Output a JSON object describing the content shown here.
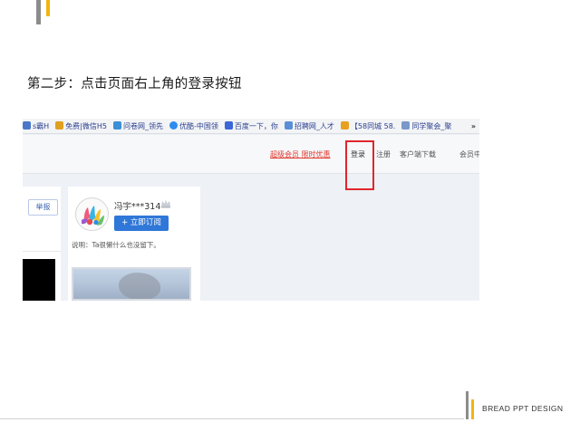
{
  "slide": {
    "step_title": "第二步：点击页面右上角的登录按钮",
    "brand": "BREAD PPT DESIGN",
    "accent_color": "#f2b50f",
    "bar_color": "#8c8c8c"
  },
  "screenshot": {
    "bookmarks": [
      {
        "label": "s霸H",
        "icon": "page-icon",
        "color": "#4a78c8"
      },
      {
        "label": "免费|微信H5",
        "icon": "puzzle-icon",
        "color": "#e0a020"
      },
      {
        "label": "问卷网_领先",
        "icon": "form-icon",
        "color": "#3a8fd8"
      },
      {
        "label": "优酷-中国领",
        "icon": "play-icon",
        "color": "#2d8cf0"
      },
      {
        "label": "百度一下，你",
        "icon": "paw-icon",
        "color": "#3a66d8"
      },
      {
        "label": "招聘网_人才",
        "icon": "page-icon",
        "color": "#5a8fd8"
      },
      {
        "label": "【58同城 58.",
        "icon": "58-icon",
        "color": "#e8a020"
      },
      {
        "label": "同学聚会_聚",
        "icon": "page-icon",
        "color": "#7a98c8"
      }
    ],
    "more_label": "»",
    "nav": {
      "vip": "超级会员 限时优惠",
      "login": "登录",
      "register": "注册",
      "client_download": "客户端下载",
      "member_center": "会员中心"
    },
    "highlight_color": "#e0262c",
    "report_label": "举报",
    "user": {
      "name": "冯宇***314",
      "subscribe_label": "+ 立即订阅",
      "description": "说明：Ta很懒什么也没留下。"
    },
    "button_color": "#2f77d8"
  }
}
